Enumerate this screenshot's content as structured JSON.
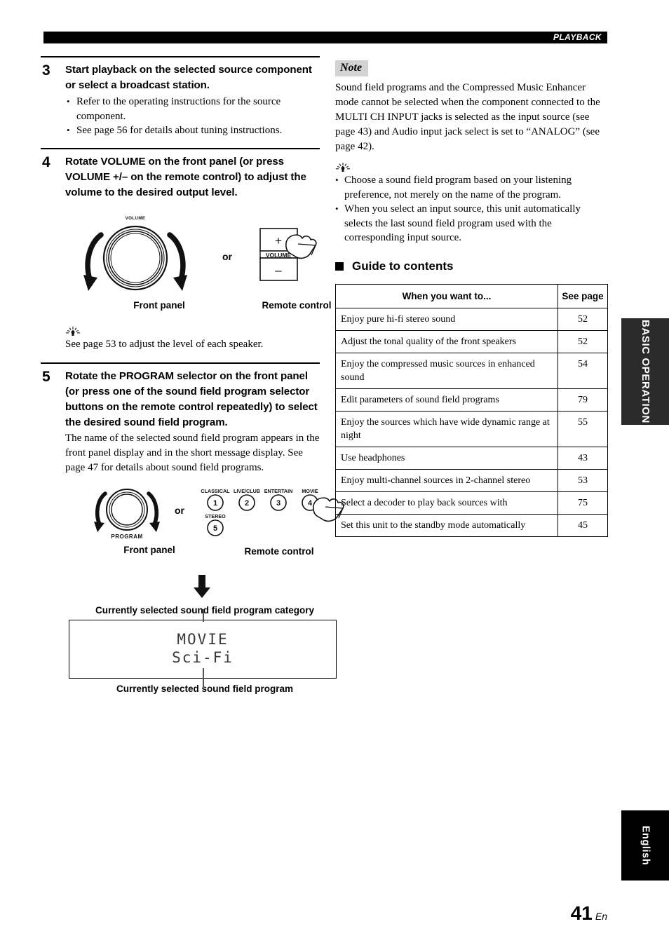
{
  "header": {
    "section_label": "PLAYBACK"
  },
  "steps": [
    {
      "number": "3",
      "title": "Start playback on the selected source component or select a broadcast station.",
      "bullets": [
        "Refer to the operating instructions for the source component.",
        "See page 56 for details about tuning instructions."
      ]
    },
    {
      "number": "4",
      "title": "Rotate VOLUME on the front panel (or press VOLUME +/– on the remote control) to adjust the volume to the desired output level."
    },
    {
      "number": "5",
      "title": "Rotate the PROGRAM selector on the front panel (or press one of the sound field program selector buttons on the remote control repeatedly) to select the desired sound field program.",
      "paragraph": "The name of the selected sound field program appears in the front panel display and in the short message display. See page 47 for details about sound field programs."
    }
  ],
  "volume_figure": {
    "knob_label": "VOLUME",
    "or_label": "or",
    "remote_plus": "+",
    "remote_minus": "–",
    "remote_volume_label": "VOLUME",
    "caption_front": "Front panel",
    "caption_remote": "Remote control"
  },
  "volume_tip": {
    "icon": "tip-bulb-icon",
    "text": "See page 53 to adjust the level of each speaker."
  },
  "program_figure": {
    "knob_label": "PROGRAM",
    "or_label": "or",
    "caption_front": "Front panel",
    "caption_remote": "Remote control",
    "buttons": [
      {
        "label": "CLASSICAL",
        "number": "1"
      },
      {
        "label": "LIVE/CLUB",
        "number": "2"
      },
      {
        "label": "ENTERTAIN",
        "number": "3"
      },
      {
        "label": "MOVIE",
        "number": "4"
      },
      {
        "label": "STEREO",
        "number": "5"
      }
    ]
  },
  "display_figure": {
    "caption_top": "Currently selected sound field program category",
    "lcd_line1": "MOVIE",
    "lcd_line2": "Sci-Fi",
    "caption_bottom": "Currently selected sound field program"
  },
  "note": {
    "tag": "Note",
    "text": "Sound field programs and the Compressed Music Enhancer mode cannot be selected when the component connected to the MULTI CH INPUT jacks is selected as the input source (see page 43) and Audio input jack select is set to “ANALOG” (see page 42)."
  },
  "note_tips": {
    "icon": "tip-bulb-icon",
    "items": [
      "Choose a sound field program based on your listening preference, not merely on the name of the program.",
      "When you select an input source, this unit automatically selects the last sound field program used with the corresponding input source."
    ]
  },
  "guide": {
    "heading": "Guide to contents",
    "columns": [
      "When you want to...",
      "See page"
    ],
    "rows": [
      {
        "desc": "Enjoy pure hi-fi stereo sound",
        "page": "52"
      },
      {
        "desc": "Adjust the tonal quality of the front speakers",
        "page": "52"
      },
      {
        "desc": "Enjoy the compressed music sources in enhanced sound",
        "page": "54"
      },
      {
        "desc": "Edit parameters of sound field programs",
        "page": "79"
      },
      {
        "desc": "Enjoy the sources which have wide dynamic range at night",
        "page": "55"
      },
      {
        "desc": "Use headphones",
        "page": "43"
      },
      {
        "desc": "Enjoy multi-channel sources in 2-channel stereo",
        "page": "53"
      },
      {
        "desc": "Select a decoder to play back sources with",
        "page": "75"
      },
      {
        "desc": "Set this unit to the standby mode automatically",
        "page": "45"
      }
    ]
  },
  "side_tabs": {
    "basic_operation": "BASIC OPERATION",
    "language": "English"
  },
  "footer": {
    "page_number": "41",
    "page_suffix": "En"
  },
  "colors": {
    "header_bar": "#000000",
    "note_tag_bg": "#d3d3d3",
    "tab_basic_bg": "#2b2b2b",
    "tab_language_bg": "#000000"
  }
}
